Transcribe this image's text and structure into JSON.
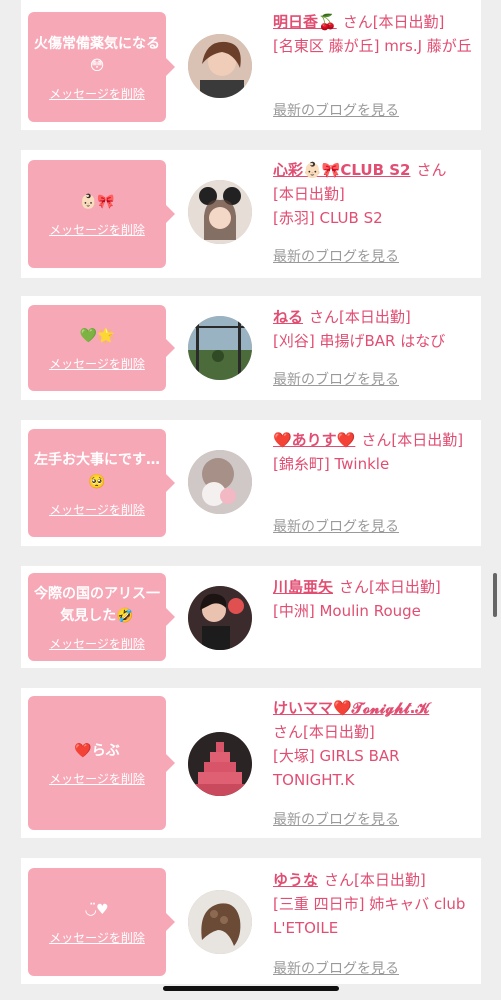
{
  "san_label": "さん",
  "delete_label": "メッセージを削除",
  "blog_label": "最新のブログを見る",
  "cards": [
    {
      "message": "火傷常備薬気になる😳",
      "name": "明日香🍒",
      "status": "[本日出勤]",
      "shop": "[名東区 藤が丘] mrs.J 藤が丘",
      "avatar": "woman-portrait-avatar"
    },
    {
      "message": "👶🏻🎀",
      "name": "心彩👶🏻🎀CLUB S2",
      "status": "[本日出勤]",
      "shop": "[赤羽] CLUB S2",
      "avatar": "mouse-ears-portrait-avatar"
    },
    {
      "message": "💚🌟",
      "name": "ねる",
      "status": "[本日出勤]",
      "shop": "[刈谷] 串揚げBAR はなび",
      "avatar": "landscape-avatar"
    },
    {
      "message": "左手お大事にです…🥺",
      "name": "❤️ありす❤️",
      "status": "[本日出勤]",
      "shop": "[錦糸町] Twinkle",
      "avatar": "blurred-portrait-avatar"
    },
    {
      "message": "今際の国のアリス一気見した🤣",
      "name": "川島亜矢",
      "status": "[本日出勤]",
      "shop": "[中洲] Moulin Rouge",
      "avatar": "dress-portrait-avatar"
    },
    {
      "message": "❤️らぶ",
      "name": "けいママ❤️𝓣𝓸𝓷𝓲𝓰𝓱𝓽.𝓚",
      "status": "[本日出勤]",
      "shop": "[大塚] GIRLS BAR TONIGHT.K",
      "avatar": "can-tower-avatar"
    },
    {
      "message": "◡̈♥︎",
      "name": "ゆうな",
      "status": "[本日出勤]",
      "shop": "[三重 四日市] 姉キャバ club L'ETOILE",
      "avatar": "hairstyle-avatar"
    }
  ]
}
